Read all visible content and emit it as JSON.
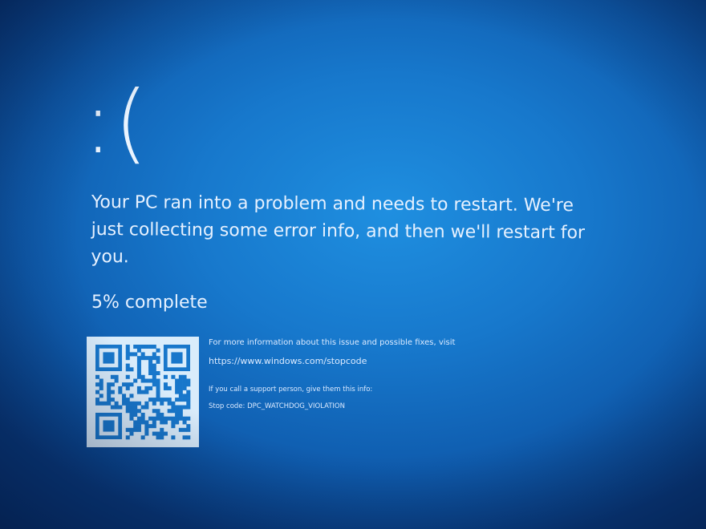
{
  "bsod": {
    "frown": ":(",
    "message": "Your PC ran into a problem and needs to restart. We're just collecting some error info, and then we'll restart for you.",
    "progress_percent": 5,
    "progress_text": "5% complete",
    "more_info": "For more information about this issue and possible fixes, visit",
    "url": "https://www.windows.com/stopcode",
    "support_text": "If you call a support person, give them this info:",
    "stop_code_text": "Stop code: DPC_WATCHDOG_VIOLATION"
  },
  "colors": {
    "background": "#1778cc",
    "text": "#e6f1ff",
    "qr_background": "#d9ecfb",
    "qr_foreground": "#1877cb"
  },
  "icons": {
    "qr": "qr-code-icon"
  }
}
